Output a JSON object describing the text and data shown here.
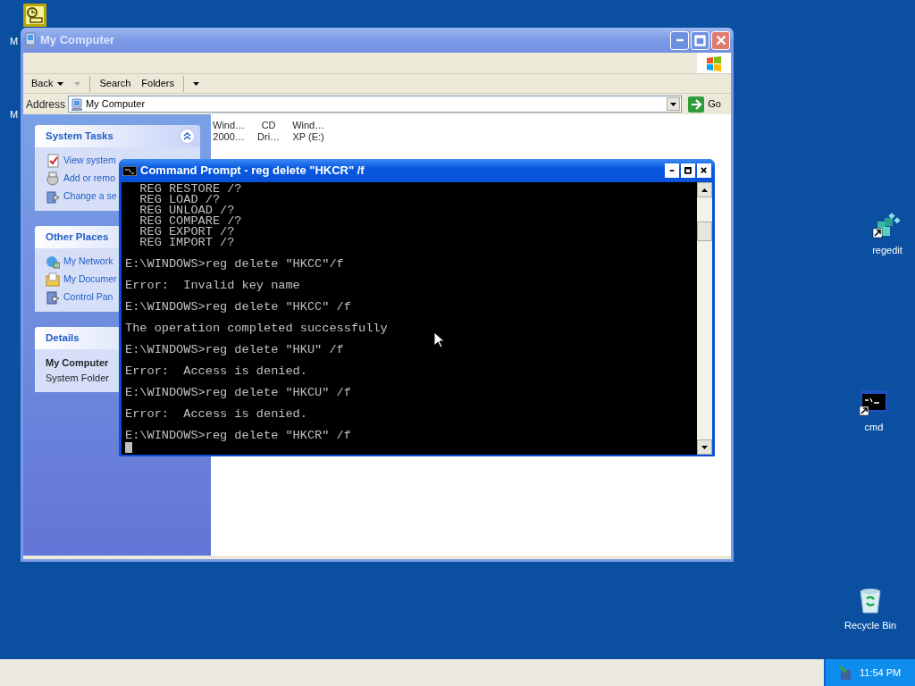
{
  "desktop": {
    "label_fragments": [
      "M",
      "M"
    ],
    "icons": [
      {
        "kind": "regedit",
        "label": "regedit"
      },
      {
        "kind": "cmd",
        "label": "cmd"
      },
      {
        "kind": "recycle",
        "label": "Recycle Bin"
      }
    ]
  },
  "explorer": {
    "title": "My Computer",
    "active": false,
    "toolbar": [
      {
        "kind": "split",
        "label": "Back",
        "disabled": false
      },
      {
        "kind": "caret",
        "disabled": true
      },
      {
        "kind": "separator"
      },
      {
        "kind": "button",
        "label": "Search",
        "disabled": false
      },
      {
        "kind": "button",
        "label": "Folders",
        "disabled": false
      },
      {
        "kind": "separator"
      },
      {
        "kind": "caret",
        "disabled": false
      }
    ],
    "address": {
      "label": "Address",
      "value": "My Computer",
      "go": "Go"
    },
    "panels": [
      {
        "kind": "links",
        "title": "System Tasks",
        "expanded": true,
        "items": [
          "View system",
          "Add or remo",
          "Change a se"
        ]
      },
      {
        "kind": "links",
        "title": "Other Places",
        "items": [
          "My Network",
          "My Documer",
          "Control Pan"
        ]
      },
      {
        "kind": "details",
        "title": "Details",
        "name": "My Computer",
        "type": "System Folder"
      }
    ],
    "drives": [
      {
        "line1": "Wind…",
        "line2": "2000…"
      },
      {
        "line1": "CD",
        "line2": "Dri…"
      },
      {
        "line1": "Wind…",
        "line2": "XP (E:)"
      }
    ]
  },
  "console": {
    "title": "Command Prompt - reg delete \"HKCR\" /f",
    "active": true,
    "blocks": [
      {
        "lines": [
          "  REG RESTORE /?",
          "  REG LOAD /?",
          "  REG UNLOAD /?",
          "  REG COMPARE /?",
          "  REG EXPORT /?",
          "  REG IMPORT /?"
        ]
      },
      {
        "lines": [
          "E:\\WINDOWS>reg delete \"HKCC\"/f"
        ]
      },
      {
        "lines": [
          "Error:  Invalid key name"
        ]
      },
      {
        "lines": [
          "E:\\WINDOWS>reg delete \"HKCC\" /f"
        ]
      },
      {
        "lines": [
          "The operation completed successfully"
        ]
      },
      {
        "lines": [
          "E:\\WINDOWS>reg delete \"HKU\" /f"
        ]
      },
      {
        "lines": [
          "Error:  Access is denied."
        ]
      },
      {
        "lines": [
          "E:\\WINDOWS>reg delete \"HKCU\" /f"
        ]
      },
      {
        "lines": [
          "Error:  Access is denied."
        ]
      },
      {
        "lines": [
          "E:\\WINDOWS>reg delete \"HKCR\" /f"
        ]
      }
    ]
  },
  "taskbar": {
    "clock": "11:54 PM"
  }
}
